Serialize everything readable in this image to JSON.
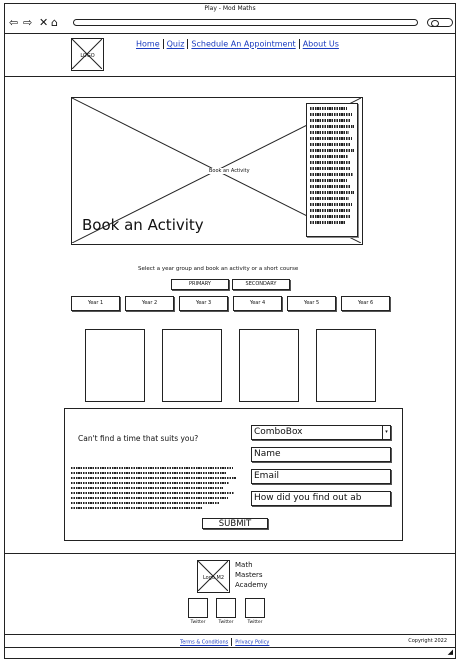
{
  "window": {
    "title": "Play - Mod Maths"
  },
  "toolbar": {
    "icons": [
      "back-arrow-icon",
      "forward-arrow-icon",
      "close-icon",
      "home-icon"
    ]
  },
  "header": {
    "logo_label": "LOGO",
    "nav": [
      "Home",
      "Quiz",
      "Schedule An Appointment",
      "About Us"
    ]
  },
  "hero": {
    "image_label": "Book an Activity",
    "title": "Book an Activity"
  },
  "booking": {
    "prompt": "Select a year group and book an activity or a short course",
    "levels": [
      "PRIMARY",
      "SECONDARY"
    ],
    "years": [
      "Year 1",
      "Year 2",
      "Year 3",
      "Year 4",
      "Year 5",
      "Year 6"
    ]
  },
  "contact": {
    "question": "Can't find a time that suits you?",
    "combo_value": "ComboBox",
    "name_placeholder": "Name",
    "email_placeholder": "Email",
    "source_placeholder": "How did you find out ab",
    "submit_label": "SUBMIT"
  },
  "footer": {
    "logo_label": "Logo M2",
    "brand_lines": [
      "Math",
      "Masters",
      "Academy"
    ],
    "social": [
      "Twitter",
      "Twitter",
      "Twitter"
    ],
    "legal": [
      "Terms & Conditions",
      "Privacy Policy"
    ],
    "copyright": "Copyright 2022"
  }
}
